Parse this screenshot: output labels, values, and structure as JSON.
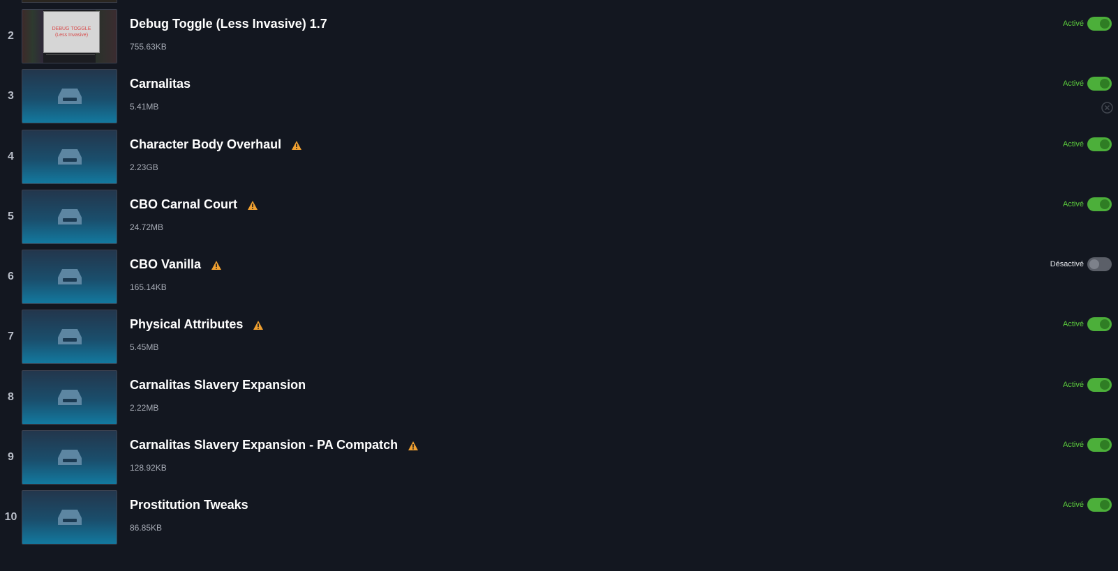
{
  "mods": [
    {
      "index": "2",
      "name": "Debug Toggle (Less Invasive) 1.7",
      "size": "755.63KB",
      "status": "Activé",
      "enabled": true,
      "warning": false,
      "thumb": "debug",
      "thumb_text": [
        "DEBUG TOGGLE",
        "(Less Invasive)"
      ]
    },
    {
      "index": "3",
      "name": "Carnalitas",
      "size": "5.41MB",
      "status": "Activé",
      "enabled": true,
      "warning": false,
      "thumb": "drive",
      "show_remove": true
    },
    {
      "index": "4",
      "name": "Character Body Overhaul",
      "size": "2.23GB",
      "status": "Activé",
      "enabled": true,
      "warning": true,
      "thumb": "drive"
    },
    {
      "index": "5",
      "name": "CBO Carnal Court",
      "size": "24.72MB",
      "status": "Activé",
      "enabled": true,
      "warning": true,
      "thumb": "drive"
    },
    {
      "index": "6",
      "name": "CBO Vanilla",
      "size": "165.14KB",
      "status": "Désactivé",
      "enabled": false,
      "warning": true,
      "thumb": "drive"
    },
    {
      "index": "7",
      "name": "Physical Attributes",
      "size": "5.45MB",
      "status": "Activé",
      "enabled": true,
      "warning": true,
      "thumb": "drive"
    },
    {
      "index": "8",
      "name": "Carnalitas Slavery Expansion",
      "size": "2.22MB",
      "status": "Activé",
      "enabled": true,
      "warning": false,
      "thumb": "drive"
    },
    {
      "index": "9",
      "name": "Carnalitas Slavery Expansion - PA Compatch",
      "size": "128.92KB",
      "status": "Activé",
      "enabled": true,
      "warning": true,
      "thumb": "drive"
    },
    {
      "index": "10",
      "name": "Prostitution Tweaks",
      "size": "86.85KB",
      "status": "Activé",
      "enabled": true,
      "warning": false,
      "thumb": "drive"
    }
  ],
  "icons": {
    "thumbnail": "drive-icon",
    "warning": "warning-icon",
    "remove": "remove-icon"
  },
  "colors": {
    "background": "#131720",
    "enabled": "#4caf3a",
    "enabled_text": "#5ccf3c",
    "disabled": "#5b5f68",
    "warning": "#f0a030"
  }
}
